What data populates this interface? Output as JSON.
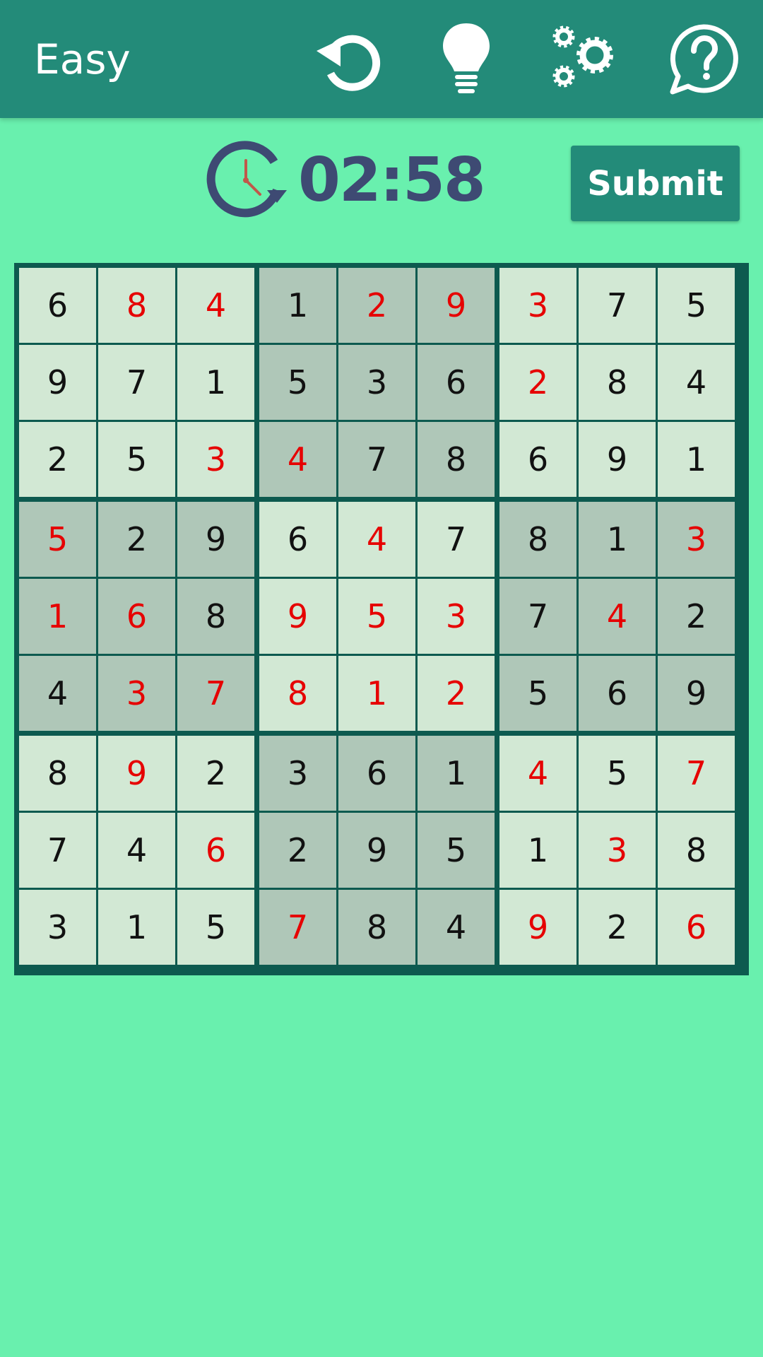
{
  "header": {
    "level": "Easy",
    "icons": [
      "restart-icon",
      "hint-bulb-icon",
      "settings-gears-icon",
      "help-question-icon"
    ]
  },
  "timer": {
    "value": "02:58",
    "icon": "timer-clock-icon"
  },
  "submit_label": "Submit",
  "colors": {
    "topbar": "#238b79",
    "background": "#69f0ae",
    "cell_light": "#d2e8d4",
    "cell_dark": "#afc7b8",
    "given_digit": "#111111",
    "entered_digit": "#e60000",
    "grid_lines": "#0d5a4f",
    "timer_text": "#3e4a73"
  },
  "board": {
    "values": [
      [
        "6",
        "8",
        "4",
        "1",
        "2",
        "9",
        "3",
        "7",
        "5"
      ],
      [
        "9",
        "7",
        "1",
        "5",
        "3",
        "6",
        "2",
        "8",
        "4"
      ],
      [
        "2",
        "5",
        "3",
        "4",
        "7",
        "8",
        "6",
        "9",
        "1"
      ],
      [
        "5",
        "2",
        "9",
        "6",
        "4",
        "7",
        "8",
        "1",
        "3"
      ],
      [
        "1",
        "6",
        "8",
        "9",
        "5",
        "3",
        "7",
        "4",
        "2"
      ],
      [
        "4",
        "3",
        "7",
        "8",
        "1",
        "2",
        "5",
        "6",
        "9"
      ],
      [
        "8",
        "9",
        "2",
        "3",
        "6",
        "1",
        "4",
        "5",
        "7"
      ],
      [
        "7",
        "4",
        "6",
        "2",
        "9",
        "5",
        "1",
        "3",
        "8"
      ],
      [
        "3",
        "1",
        "5",
        "7",
        "8",
        "4",
        "9",
        "2",
        "6"
      ]
    ],
    "entered": [
      [
        0,
        1,
        1,
        0,
        1,
        1,
        1,
        0,
        0
      ],
      [
        0,
        0,
        0,
        0,
        0,
        0,
        1,
        0,
        0
      ],
      [
        0,
        0,
        1,
        1,
        0,
        0,
        0,
        0,
        0
      ],
      [
        1,
        0,
        0,
        0,
        1,
        0,
        0,
        0,
        1
      ],
      [
        1,
        1,
        0,
        1,
        1,
        1,
        0,
        1,
        0
      ],
      [
        0,
        1,
        1,
        1,
        1,
        1,
        0,
        0,
        0
      ],
      [
        0,
        1,
        0,
        0,
        0,
        0,
        1,
        0,
        1
      ],
      [
        0,
        0,
        1,
        0,
        0,
        0,
        0,
        1,
        0
      ],
      [
        0,
        0,
        0,
        1,
        0,
        0,
        1,
        0,
        1
      ]
    ]
  }
}
